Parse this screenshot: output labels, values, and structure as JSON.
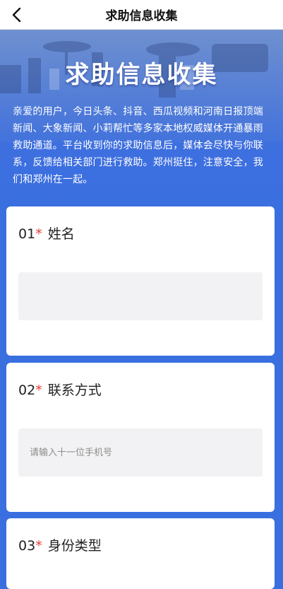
{
  "nav": {
    "title": "求助信息收集"
  },
  "hero": {
    "title": "求助信息收集",
    "intro": "亲爱的用户，今日头条、抖音、西瓜视频和河南日报顶端新闻、大象新闻、小莉帮忙等多家本地权威媒体开通暴雨救助通道。平台收到你的求助信息后，媒体会尽快与你联系，反馈给相关部门进行救助。郑州挺住，注意安全，我们和郑州在一起。"
  },
  "form": {
    "fields": [
      {
        "number": "01",
        "required": "*",
        "label": "姓名",
        "value": "",
        "placeholder": ""
      },
      {
        "number": "02",
        "required": "*",
        "label": "联系方式",
        "value": "",
        "placeholder": "请输入十一位手机号"
      },
      {
        "number": "03",
        "required": "*",
        "label": "身份类型"
      }
    ]
  },
  "colors": {
    "accent": "#3a6fe0",
    "required": "#e53935",
    "input_bg": "#f2f2f4"
  }
}
